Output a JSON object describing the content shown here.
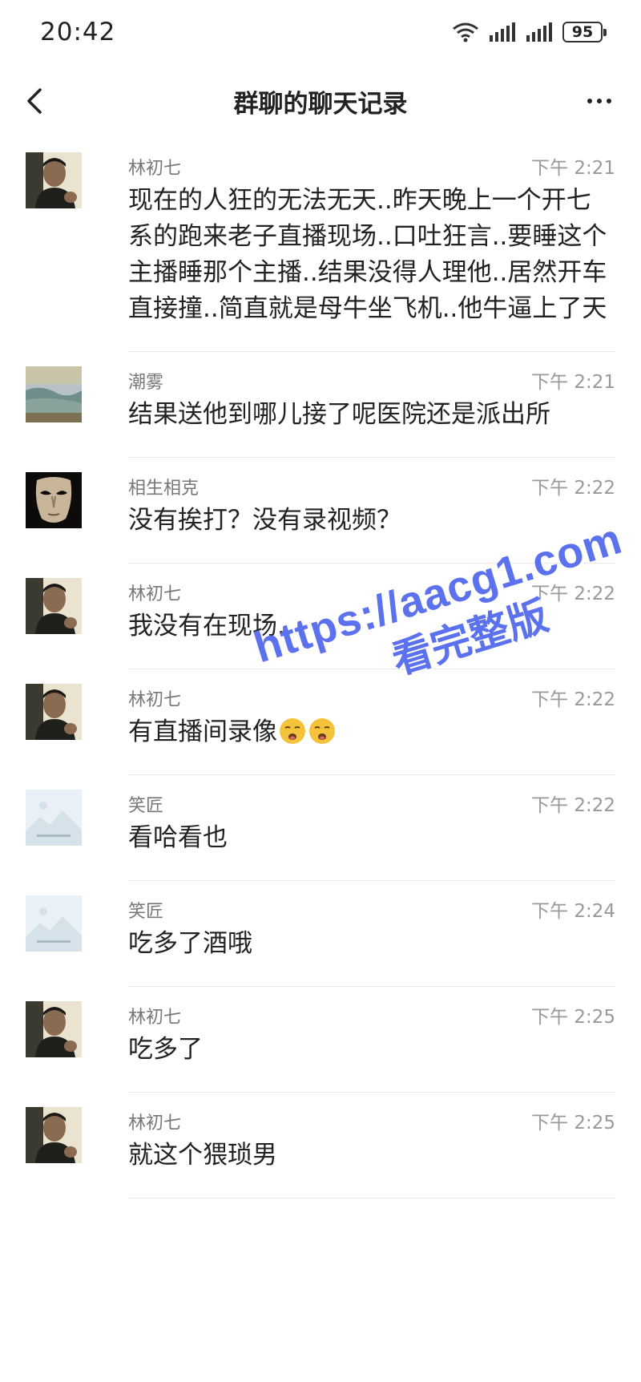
{
  "status_bar": {
    "time": "20:42",
    "battery": "95"
  },
  "header": {
    "title": "群聊的聊天记录"
  },
  "messages": [
    {
      "sender": "林初七",
      "time": "下午 2:21",
      "text": "现在的人狂的无法无天..昨天晚上一个开七系的跑来老子直播现场..口吐狂言..要睡这个主播睡那个主播..结果没得人理他..居然开车直接撞..简直就是母牛坐飞机..他牛逼上了天",
      "avatar": "man-avatar"
    },
    {
      "sender": "潮雾",
      "time": "下午 2:21",
      "text": "结果送他到哪儿接了呢医院还是派出所",
      "avatar": "landscape-avatar"
    },
    {
      "sender": "相生相克",
      "time": "下午 2:22",
      "text": "没有挨打？没有录视频？",
      "avatar": "mask-avatar"
    },
    {
      "sender": "林初七",
      "time": "下午 2:22",
      "text": "我没有在现场..",
      "avatar": "man-avatar"
    },
    {
      "sender": "林初七",
      "time": "下午 2:22",
      "text": "有直播间录像",
      "avatar": "man-avatar",
      "emojis": [
        "sleepy-face-emoji",
        "sleepy-face-emoji"
      ]
    },
    {
      "sender": "笑匠",
      "time": "下午 2:22",
      "text": "看哈看也",
      "avatar": "placeholder-avatar"
    },
    {
      "sender": "笑匠",
      "time": "下午 2:24",
      "text": "吃多了酒哦",
      "avatar": "placeholder-avatar"
    },
    {
      "sender": "林初七",
      "time": "下午 2:25",
      "text": "吃多了",
      "avatar": "man-avatar"
    },
    {
      "sender": "林初七",
      "time": "下午 2:25",
      "text": "就这个猥琐男",
      "avatar": "man-avatar"
    }
  ],
  "watermark": {
    "url": "https://aacg1.com",
    "sub": "看完整版"
  }
}
